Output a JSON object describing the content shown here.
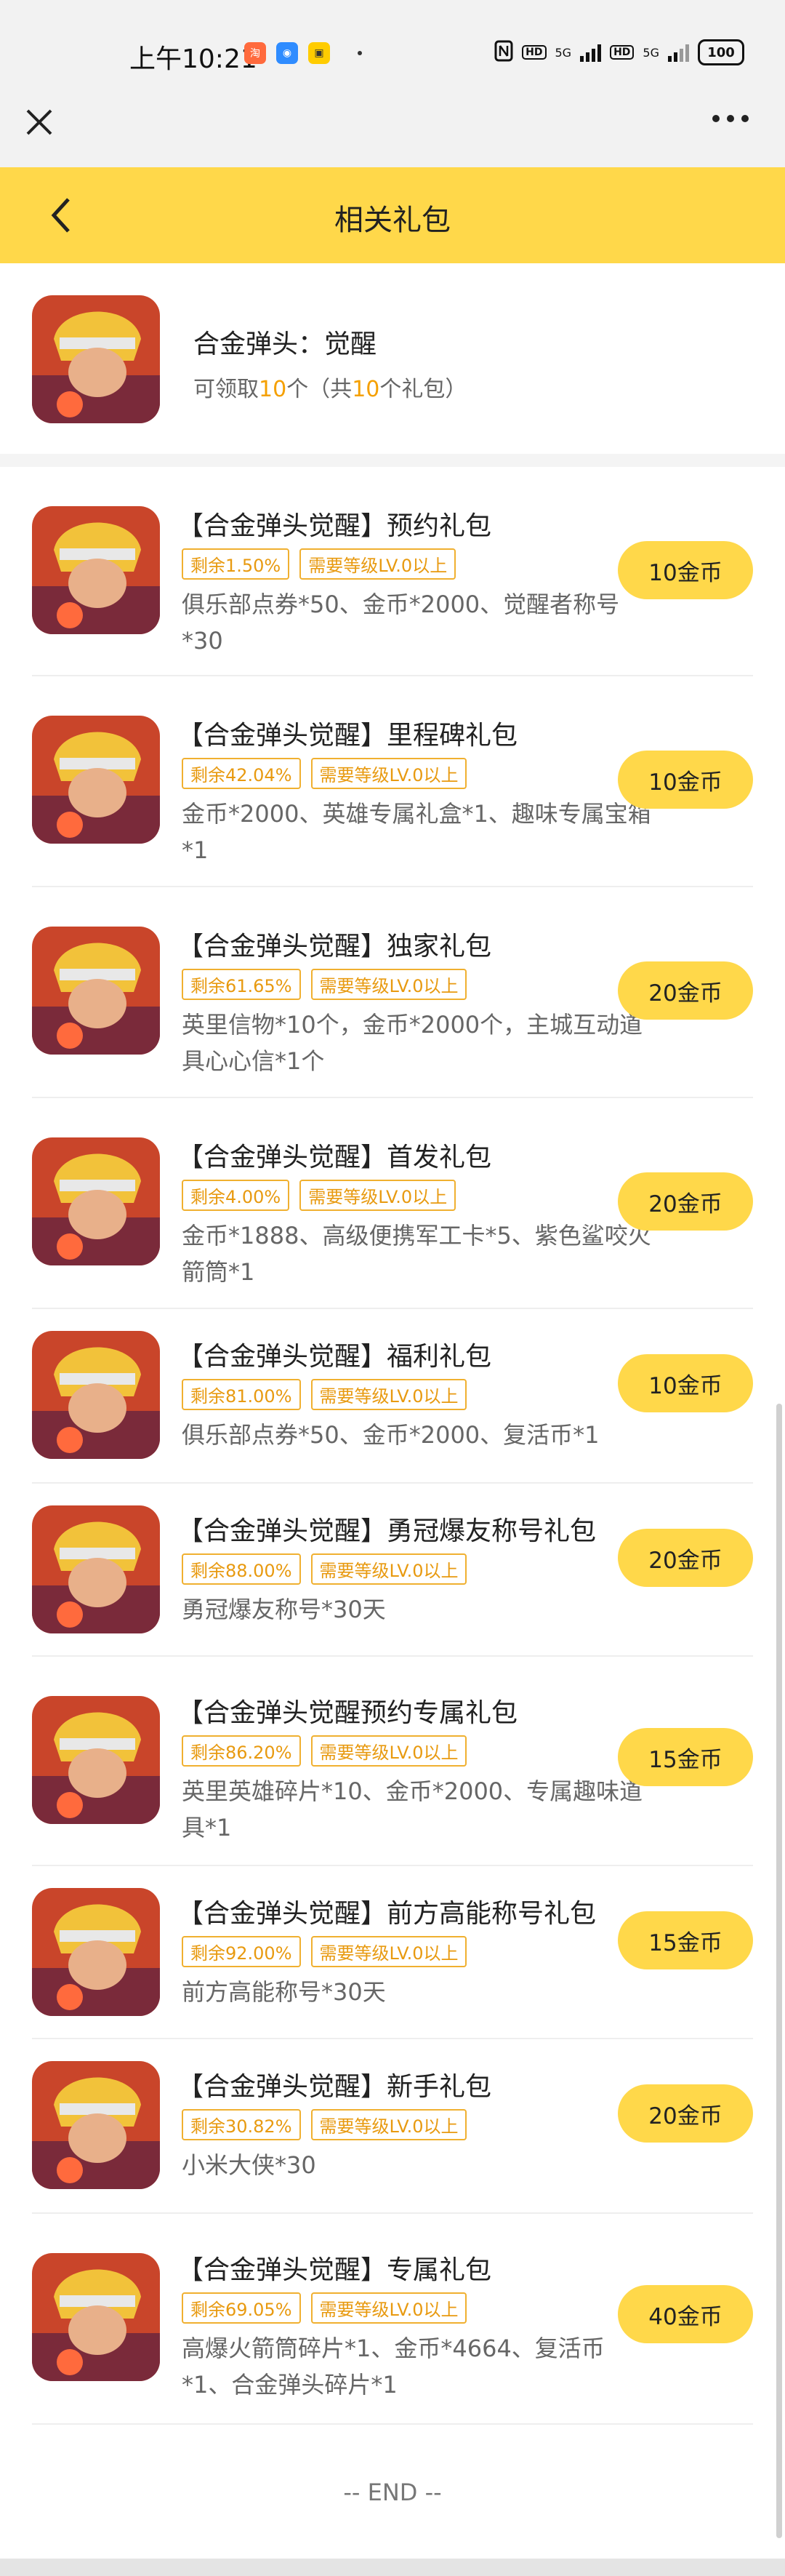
{
  "status_bar": {
    "time": "上午10:21",
    "network": "5G",
    "hd": "HD",
    "battery": "100"
  },
  "header": {
    "title": "相关礼包"
  },
  "game": {
    "name": "合金弹头：觉醒",
    "available_prefix": "可领取",
    "available_count": "10",
    "available_mid": "个（共",
    "total_count": "10",
    "available_suffix": "个礼包）"
  },
  "gifts": [
    {
      "title": "【合金弹头觉醒】预约礼包",
      "remaining": "剩余1.50%",
      "level": "需要等级LV.0以上",
      "desc": "俱乐部点券*50、金币*2000、觉醒者称号*30",
      "price": "10金币"
    },
    {
      "title": "【合金弹头觉醒】里程碑礼包",
      "remaining": "剩余42.04%",
      "level": "需要等级LV.0以上",
      "desc": "金币*2000、英雄专属礼盒*1、趣味专属宝箱*1",
      "price": "10金币"
    },
    {
      "title": "【合金弹头觉醒】独家礼包",
      "remaining": "剩余61.65%",
      "level": "需要等级LV.0以上",
      "desc": "英里信物*10个，金币*2000个，主城互动道具心心信*1个",
      "price": "20金币"
    },
    {
      "title": "【合金弹头觉醒】首发礼包",
      "remaining": "剩余4.00%",
      "level": "需要等级LV.0以上",
      "desc": "金币*1888、高级便携军工卡*5、紫色鲨咬火箭筒*1",
      "price": "20金币"
    },
    {
      "title": "【合金弹头觉醒】福利礼包",
      "remaining": "剩余81.00%",
      "level": "需要等级LV.0以上",
      "desc": "俱乐部点券*50、金币*2000、复活币*1",
      "price": "10金币"
    },
    {
      "title": "【合金弹头觉醒】勇冠爆友称号礼包",
      "remaining": "剩余88.00%",
      "level": "需要等级LV.0以上",
      "desc": "勇冠爆友称号*30天",
      "price": "20金币"
    },
    {
      "title": "【合金弹头觉醒预约专属礼包",
      "remaining": "剩余86.20%",
      "level": "需要等级LV.0以上",
      "desc": "英里英雄碎片*10、金币*2000、专属趣味道具*1",
      "price": "15金币"
    },
    {
      "title": "【合金弹头觉醒】前方高能称号礼包",
      "remaining": "剩余92.00%",
      "level": "需要等级LV.0以上",
      "desc": "前方高能称号*30天",
      "price": "15金币"
    },
    {
      "title": "【合金弹头觉醒】新手礼包",
      "remaining": "剩余30.82%",
      "level": "需要等级LV.0以上",
      "desc": "小米大侠*30",
      "price": "20金币"
    },
    {
      "title": "【合金弹头觉醒】专属礼包",
      "remaining": "剩余69.05%",
      "level": "需要等级LV.0以上",
      "desc": "高爆火箭筒碎片*1、金币*4664、复活币*1、合金弹头碎片*1",
      "price": "40金币"
    }
  ],
  "footer": {
    "end": "-- END --"
  },
  "colors": {
    "accent": "#ffd84a",
    "highlight": "#f5a000"
  }
}
